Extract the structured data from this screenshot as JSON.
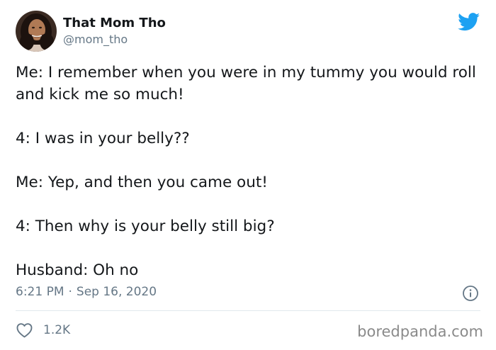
{
  "author": {
    "display_name": "That Mom Tho",
    "handle": "@mom_tho",
    "avatar_icon": "profile-photo"
  },
  "brand": {
    "logo_icon": "twitter-bird-icon",
    "accent_color": "#1da1f2"
  },
  "tweet": {
    "lines": [
      "Me: I remember when you were in my tummy you would roll and kick me so much!",
      "4: I was in your belly??",
      "Me: Yep, and then you came out!",
      "4: Then why is your belly still big?",
      "Husband: Oh no"
    ],
    "time": "6:21 PM",
    "separator": "·",
    "date": "Sep 16, 2020"
  },
  "actions": {
    "like_icon": "heart-icon",
    "like_count": "1.2K",
    "info_icon": "info-icon"
  },
  "watermark": "boredpanda.com",
  "colors": {
    "text": "#14171a",
    "secondary_text": "#657786",
    "divider": "#e1e8ed"
  }
}
